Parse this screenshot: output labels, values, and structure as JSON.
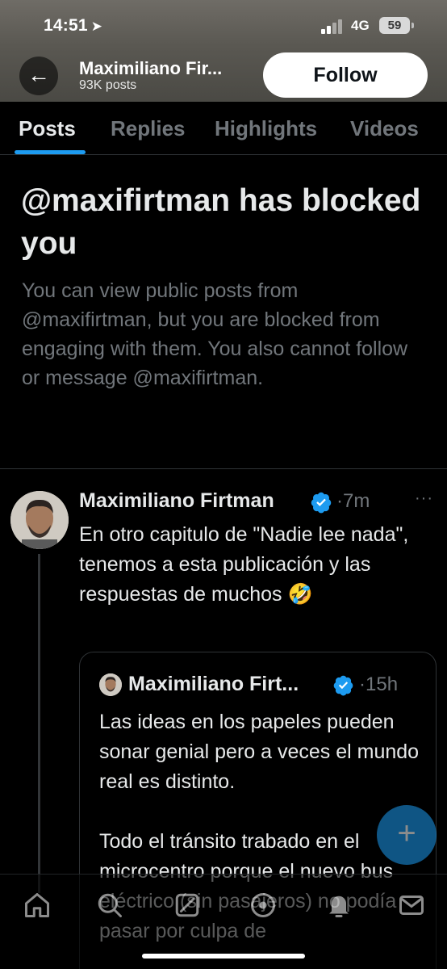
{
  "status_bar": {
    "time": "14:51",
    "network": "4G",
    "battery": "59"
  },
  "header": {
    "name": "Maximiliano Fir...",
    "post_count": "93K posts",
    "follow_label": "Follow"
  },
  "tabs": [
    {
      "label": "Posts",
      "active": true
    },
    {
      "label": "Replies",
      "active": false
    },
    {
      "label": "Highlights",
      "active": false
    },
    {
      "label": "Videos",
      "active": false
    }
  ],
  "blocked": {
    "title": "@maxifirtman has blocked you",
    "description": "You can view public posts from @maxifirtman, but you are blocked from engaging with them. You also cannot follow or message @maxifirtman."
  },
  "tweet": {
    "author": "Maximiliano Firtman",
    "time": "7m",
    "more": "···",
    "text": "En otro capitulo de \"Nadie lee nada\", tenemos a esta publicación y las respuestas de muchos 🤣"
  },
  "quoted_tweet": {
    "author": "Maximiliano Firt...",
    "time": "15h",
    "paragraphs": [
      "Las ideas en los papeles pueden sonar genial pero a veces el mundo real es distinto.",
      "Todo el tránsito trabado en el microcentro porque el nuevo bus eléctrico (sin pasajeros) no podía pasar por culpa de"
    ]
  },
  "fab": {
    "label": "+"
  },
  "bottom_nav": [
    "home-icon",
    "search-icon",
    "grok-icon",
    "communities-icon",
    "notifications-icon",
    "messages-icon"
  ],
  "colors": {
    "accent": "#1d9bf0",
    "background": "#000000",
    "muted": "#71767b"
  }
}
